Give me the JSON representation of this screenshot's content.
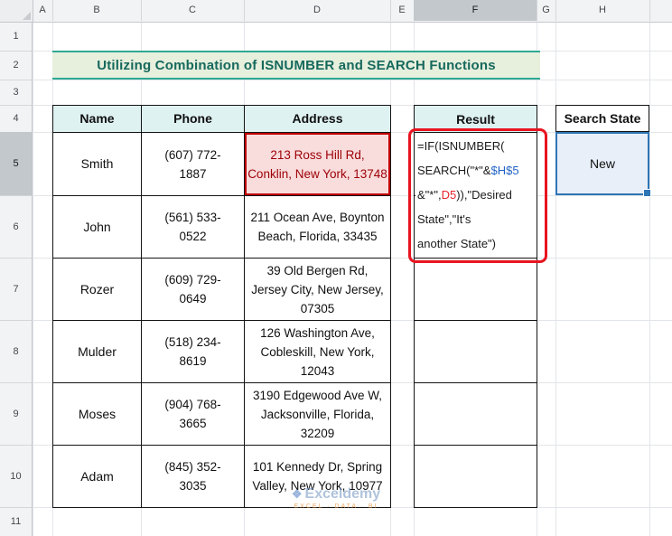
{
  "sheet": {
    "column_headers": [
      "A",
      "B",
      "C",
      "D",
      "E",
      "F",
      "G",
      "H"
    ],
    "row_headers": [
      "1",
      "2",
      "3",
      "4",
      "5",
      "6",
      "7",
      "8",
      "9",
      "10",
      "11"
    ],
    "highlighted_column": "F",
    "highlighted_row": "5"
  },
  "title_banner": {
    "text": "Utilizing Combination of ISNUMBER and SEARCH Functions"
  },
  "table": {
    "headers": {
      "name": "Name",
      "phone": "Phone",
      "address": "Address"
    },
    "rows": [
      {
        "name": "Smith",
        "phone": "(607) 772-1887",
        "address": "213 Ross Hill Rd, Conklin, New York, 13748",
        "highlighted": true
      },
      {
        "name": "John",
        "phone": "(561) 533-0522",
        "address": "211 Ocean Ave, Boynton Beach, Florida, 33435",
        "highlighted": false
      },
      {
        "name": "Rozer",
        "phone": "(609) 729-0649",
        "address": "39 Old Bergen Rd, Jersey City, New Jersey, 07305",
        "highlighted": false
      },
      {
        "name": "Mulder",
        "phone": "(518) 234-8619",
        "address": "126 Washington Ave, Cobleskill, New York, 12043",
        "highlighted": false
      },
      {
        "name": "Moses",
        "phone": "(904) 768-3665",
        "address": "3190 Edgewood Ave W, Jacksonville, Florida, 32209",
        "highlighted": false
      },
      {
        "name": "Adam",
        "phone": "(845) 352-3035",
        "address": "101 Kennedy Dr, Spring Valley, New York, 10977",
        "highlighted": false
      }
    ]
  },
  "result": {
    "header": "Result",
    "formula_full": "=IF(ISNUMBER(SEARCH(\"*\"&$H$5&\"*\",D5)),\"Desired State\",\"It's another State\")",
    "formula_lines": {
      "l1": "=IF(ISNUMBER(",
      "l2a": "SEARCH(\"*\"&",
      "l2ref": "$H$5",
      "l3a": "&\"*\",",
      "l3ref": "D5",
      "l3b": ")),\"Desired",
      "l4": "State\",\"It's",
      "l5": "another State\")"
    }
  },
  "search_state": {
    "header": "Search State",
    "value": "New"
  },
  "watermark": {
    "brand": "Exceldemy",
    "tagline": "EXCEL · DATA · BI"
  },
  "colors": {
    "title_text": "#15695c",
    "title_fill": "#e7efdd",
    "title_border": "#2fa893",
    "table_header_fill": "#def2f1",
    "selection_blue": "#2e75b6",
    "selection_fill": "#e8eff9",
    "annotation_red": "#e81420",
    "highlight_cell_fill": "#f9dcdc",
    "highlight_cell_border": "#c00000",
    "highlight_cell_text": "#9c0006",
    "formula_ref_blue": "#1f62c5",
    "formula_ref_red": "#e8262d"
  }
}
